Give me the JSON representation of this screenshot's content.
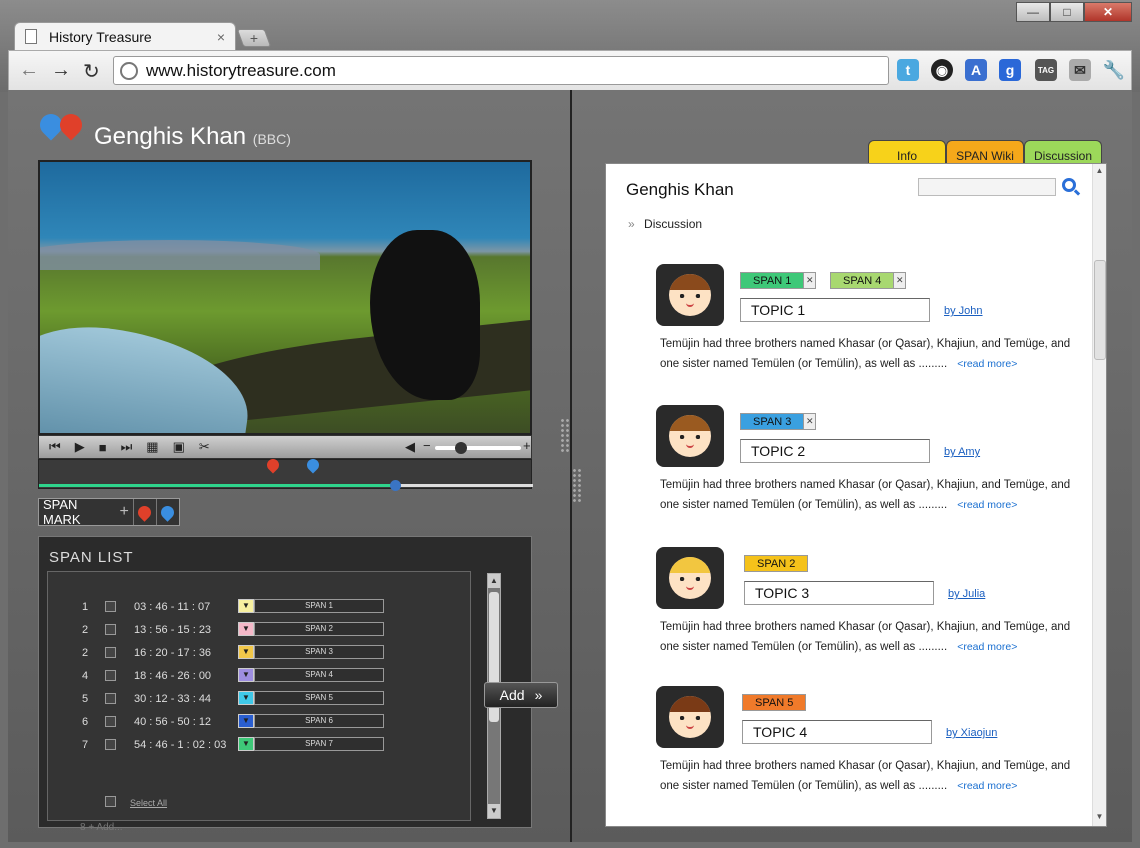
{
  "browser": {
    "tab_title": "History Treasure",
    "tab_close": "×",
    "new_tab": "+",
    "url": "www.historytreasure.com",
    "window_controls": [
      "—",
      "□",
      "✕"
    ]
  },
  "left": {
    "title": "Genghis Khan",
    "subtitle": "(BBC)",
    "span_mark_label": "SPAN MARK",
    "span_mark_plus": "+",
    "span_list": {
      "title": "SPAN  LIST",
      "rows": [
        {
          "num": "1",
          "time": "03 : 46 - 11 : 07",
          "span": "SPAN 1",
          "color": "#f7f0a0"
        },
        {
          "num": "2",
          "time": "13 : 56 - 15 : 23",
          "span": "SPAN 2",
          "color": "#f4b8c8"
        },
        {
          "num": "2",
          "time": "16 : 20 - 17 : 36",
          "span": "SPAN 3",
          "color": "#f2c84a"
        },
        {
          "num": "4",
          "time": "18 : 46 - 26 : 00",
          "span": "SPAN 4",
          "color": "#9e8ee0"
        },
        {
          "num": "5",
          "time": "30 : 12 - 33 : 44",
          "span": "SPAN 5",
          "color": "#3fc8e8"
        },
        {
          "num": "6",
          "time": "40 : 56 - 50 : 12",
          "span": "SPAN 6",
          "color": "#2a5ed0"
        },
        {
          "num": "7",
          "time": "54 : 46 - 1 : 02 : 03",
          "span": "SPAN 7",
          "color": "#3ec878"
        }
      ],
      "select_all": "Select All",
      "add_more": "8  +  Add..."
    },
    "add_button": "Add",
    "video_progress": 0.72
  },
  "right": {
    "tabs": [
      {
        "label": "Info",
        "color": "#f7d21a"
      },
      {
        "label": "SPAN Wiki",
        "color": "#f5a81a"
      },
      {
        "label": "Discussion",
        "color": "#9cd85a"
      }
    ],
    "title": "Genghis Khan",
    "breadcrumb": "Discussion",
    "read_more": "<read more>",
    "posts": [
      {
        "tags": [
          {
            "label": "SPAN 1",
            "color": "#3ec878",
            "closable": true
          },
          {
            "label": "SPAN 4",
            "color": "#a8d870",
            "closable": true
          }
        ],
        "topic": "TOPIC 1",
        "author": "by John",
        "text": "Temüjin had three brothers named Khasar (or Qasar), Khajiun, and Temüge, and one sister named Temülen (or Temülin), as well as .........",
        "hair": "#8a4a1c"
      },
      {
        "tags": [
          {
            "label": "SPAN 3",
            "color": "#3aa0e0",
            "closable": true
          }
        ],
        "topic": "TOPIC 2",
        "author": "by Amy",
        "text": "Temüjin had three brothers named Khasar (or Qasar), Khajiun, and Temüge, and one sister named Temülen (or Temülin), as well as .........",
        "hair": "#9a5a20"
      },
      {
        "tags": [
          {
            "label": "SPAN 2",
            "color": "#f5c21a",
            "closable": false
          }
        ],
        "topic": "TOPIC 3",
        "author": "by Julia",
        "text": "Temüjin had three brothers named Khasar (or Qasar), Khajiun, and Temüge, and one sister named Temülen (or Temülin), as well as .........",
        "hair": "#f2c640"
      },
      {
        "tags": [
          {
            "label": "SPAN 5",
            "color": "#f07a2a",
            "closable": false
          }
        ],
        "topic": "TOPIC 4",
        "author": "by Xiaojun",
        "text": "Temüjin had three brothers named Khasar (or Qasar), Khajiun, and Temüge, and one sister named Temülen (or Temülin), as well as .........",
        "hair": "#7a3a16"
      }
    ]
  }
}
